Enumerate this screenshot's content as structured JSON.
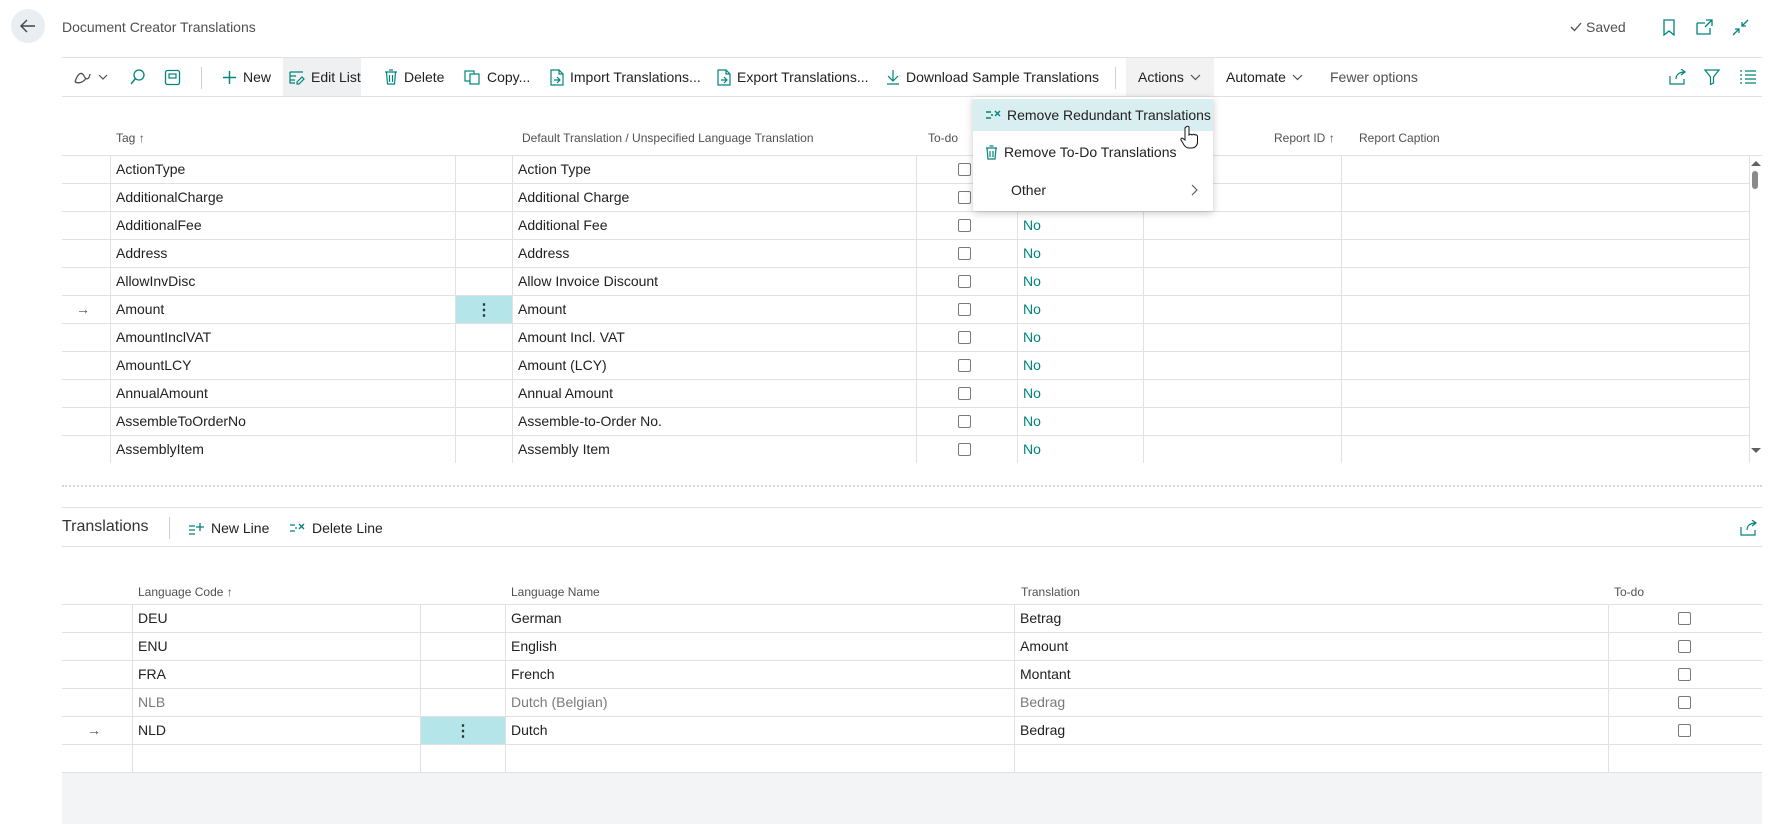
{
  "header": {
    "title": "Document Creator Translations",
    "saved_label": "Saved"
  },
  "actionbar": {
    "new_label": "New",
    "edit_list_label": "Edit List",
    "delete_label": "Delete",
    "copy_label": "Copy...",
    "import_label": "Import Translations...",
    "export_label": "Export Translations...",
    "download_label": "Download Sample Translations",
    "actions_label": "Actions",
    "automate_label": "Automate",
    "fewer_options_label": "Fewer options"
  },
  "actions_menu": {
    "items": [
      {
        "label": "Remove Redundant Translations",
        "icon": "remove-lines-icon"
      },
      {
        "label": "Remove To-Do Translations",
        "icon": "trash-icon"
      },
      {
        "label": "Other",
        "icon": "chevron-right-icon"
      }
    ]
  },
  "main_table": {
    "columns": {
      "tag": "Tag",
      "sort_indicator": "↑",
      "default_translation": "Default Translation / Unspecified Language Translation",
      "todo": "To-do",
      "report_id": "Report ID",
      "report_caption": "Report Caption"
    },
    "rows": [
      {
        "tag": "ActionType",
        "translation": "Action Type",
        "flag": ""
      },
      {
        "tag": "AdditionalCharge",
        "translation": "Additional Charge",
        "flag": ""
      },
      {
        "tag": "AdditionalFee",
        "translation": "Additional Fee",
        "flag": "No"
      },
      {
        "tag": "Address",
        "translation": "Address",
        "flag": "No"
      },
      {
        "tag": "AllowInvDisc",
        "translation": "Allow Invoice Discount",
        "flag": "No"
      },
      {
        "tag": "Amount",
        "translation": "Amount",
        "flag": "No"
      },
      {
        "tag": "AmountInclVAT",
        "translation": "Amount Incl. VAT",
        "flag": "No"
      },
      {
        "tag": "AmountLCY",
        "translation": "Amount (LCY)",
        "flag": "No"
      },
      {
        "tag": "AnnualAmount",
        "translation": "Annual Amount",
        "flag": "No"
      },
      {
        "tag": "AssembleToOrderNo",
        "translation": "Assemble-to-Order No.",
        "flag": "No"
      },
      {
        "tag": "AssemblyItem",
        "translation": "Assembly Item",
        "flag": "No"
      }
    ],
    "selected_row_index": 5
  },
  "translations_part": {
    "title": "Translations",
    "new_line_label": "New Line",
    "delete_line_label": "Delete Line",
    "columns": {
      "language_code": "Language Code",
      "sort_indicator": "↑",
      "language_name": "Language Name",
      "translation": "Translation",
      "todo": "To-do"
    },
    "rows": [
      {
        "code": "DEU",
        "name": "German",
        "translation": "Betrag",
        "dim": false
      },
      {
        "code": "ENU",
        "name": "English",
        "translation": "Amount",
        "dim": false
      },
      {
        "code": "FRA",
        "name": "French",
        "translation": "Montant",
        "dim": false
      },
      {
        "code": "NLB",
        "name": "Dutch (Belgian)",
        "translation": "Bedrag",
        "dim": true
      },
      {
        "code": "NLD",
        "name": "Dutch",
        "translation": "Bedrag",
        "dim": false
      }
    ],
    "selected_row_index": 4
  },
  "glyphs": {
    "row_arrow": "→",
    "row_menu": "⋮"
  },
  "colors": {
    "accent": "#00847c",
    "selection": "#b4e5e8",
    "menu_highlight": "#d9eef0"
  }
}
